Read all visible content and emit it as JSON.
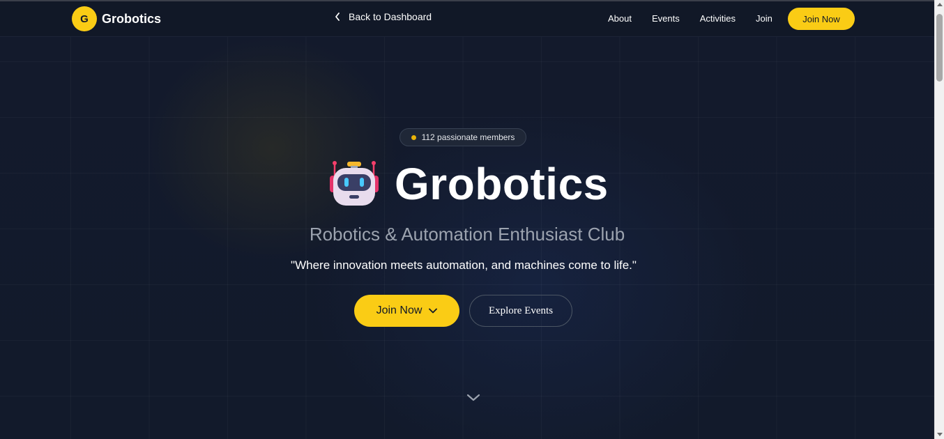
{
  "navbar": {
    "logo_letter": "G",
    "brand_name": "Grobotics",
    "back_label": "Back to Dashboard",
    "links": [
      "About",
      "Events",
      "Activities",
      "Join"
    ],
    "join_button": "Join Now"
  },
  "hero": {
    "members_badge": "112 passionate members",
    "title": "Grobotics",
    "title_icon": "robot-emoji",
    "subtitle": "Robotics & Automation Enthusiast Club",
    "tagline": "\"Where innovation meets automation, and machines come to life.\"",
    "primary_button": "Join Now",
    "secondary_button": "Explore Events"
  },
  "colors": {
    "accent": "#facc15",
    "background": "#141b2d",
    "navbar": "#111827"
  }
}
